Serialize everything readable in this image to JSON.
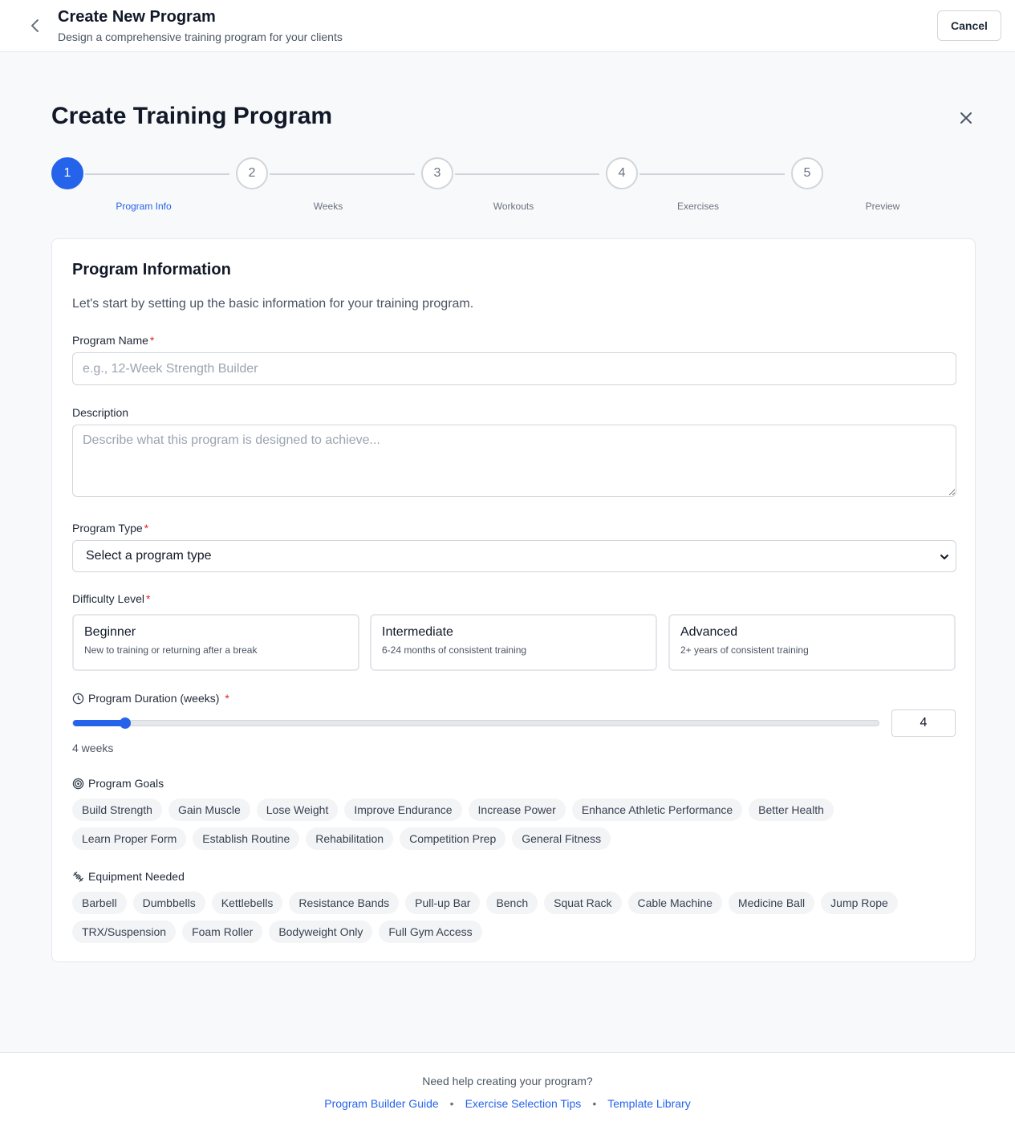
{
  "header": {
    "title": "Create New Program",
    "subtitle": "Design a comprehensive training program for your clients",
    "cancel_label": "Cancel"
  },
  "main": {
    "title": "Create Training Program"
  },
  "stepper": {
    "active_step": 1,
    "steps": [
      {
        "number": "1",
        "label": "Program Info"
      },
      {
        "number": "2",
        "label": "Weeks"
      },
      {
        "number": "3",
        "label": "Workouts"
      },
      {
        "number": "4",
        "label": "Exercises"
      },
      {
        "number": "5",
        "label": "Preview"
      }
    ]
  },
  "form": {
    "title": "Program Information",
    "description": "Let's start by setting up the basic information for your training program.",
    "program_name": {
      "label": "Program Name",
      "required_mark": "*",
      "value": "",
      "placeholder": "e.g., 12-Week Strength Builder"
    },
    "description_field": {
      "label": "Description",
      "value": "",
      "placeholder": "Describe what this program is designed to achieve..."
    },
    "program_type": {
      "label": "Program Type",
      "required_mark": "*",
      "selected": "Select a program type"
    },
    "difficulty": {
      "label": "Difficulty Level",
      "required_mark": "*",
      "options": [
        {
          "title": "Beginner",
          "subtitle": "New to training or returning after a break"
        },
        {
          "title": "Intermediate",
          "subtitle": "6-24 months of consistent training"
        },
        {
          "title": "Advanced",
          "subtitle": "2+ years of consistent training"
        }
      ]
    },
    "duration": {
      "label": "Program Duration (weeks)",
      "required_mark": "*",
      "value": "4",
      "value_text": "4 weeks",
      "slider_fraction": 0.065
    },
    "goals": {
      "label": "Program Goals",
      "row1": [
        "Build Strength",
        "Gain Muscle",
        "Lose Weight",
        "Improve Endurance",
        "Increase Power",
        "Enhance Athletic Performance",
        "Better Health"
      ],
      "row2": [
        "Learn Proper Form",
        "Establish Routine",
        "Rehabilitation",
        "Competition Prep",
        "General Fitness"
      ]
    },
    "equipment": {
      "label": "Equipment Needed",
      "row1": [
        "Barbell",
        "Dumbbells",
        "Kettlebells",
        "Resistance Bands",
        "Pull-up Bar",
        "Bench",
        "Squat Rack",
        "Cable Machine",
        "Medicine Ball",
        "Jump Rope"
      ],
      "row2": [
        "TRX/Suspension",
        "Foam Roller",
        "Bodyweight Only",
        "Full Gym Access"
      ]
    }
  },
  "footer": {
    "help_text": "Need help creating your program?",
    "links": [
      "Program Builder Guide",
      "Exercise Selection Tips",
      "Template Library"
    ],
    "separator": "•"
  },
  "colors": {
    "accent": "#2563eb",
    "required": "#dc2626",
    "chip_bg": "#f3f4f6",
    "page_bg": "#f8f9fa"
  },
  "icons": {
    "back": "chevron-left-icon",
    "close": "close-icon",
    "duration": "clock-icon",
    "goals": "target-icon",
    "equipment": "dumbbell-icon",
    "select": "chevron-down-icon"
  }
}
